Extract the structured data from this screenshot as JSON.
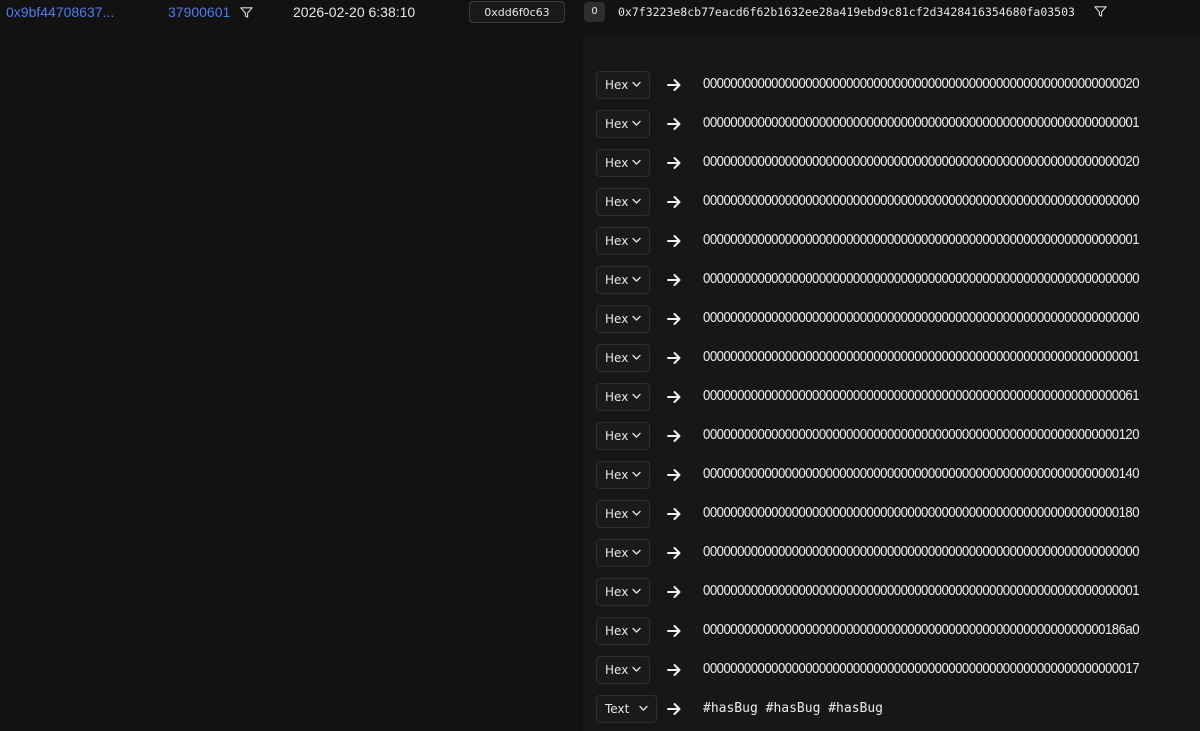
{
  "log_row": {
    "tx_hash": "0x9bf44708637...",
    "block_number": "37900601",
    "timestamp": "2026-02-20 6:38:10",
    "method": "0xdd6f0c63",
    "log_index": "0",
    "topic": "0x7f3223e8cb77eacd6f62b1632ee28a419ebd9c81cf2d3428416354680fa03503",
    "link_color": "#4d7cf0"
  },
  "decoded_rows": [
    {
      "format": "Hex",
      "value": "0000000000000000000000000000000000000000000000000000000000000020"
    },
    {
      "format": "Hex",
      "value": "0000000000000000000000000000000000000000000000000000000000000001"
    },
    {
      "format": "Hex",
      "value": "0000000000000000000000000000000000000000000000000000000000000020"
    },
    {
      "format": "Hex",
      "value": "0000000000000000000000000000000000000000000000000000000000000000"
    },
    {
      "format": "Hex",
      "value": "0000000000000000000000000000000000000000000000000000000000000001"
    },
    {
      "format": "Hex",
      "value": "0000000000000000000000000000000000000000000000000000000000000000"
    },
    {
      "format": "Hex",
      "value": "0000000000000000000000000000000000000000000000000000000000000000"
    },
    {
      "format": "Hex",
      "value": "0000000000000000000000000000000000000000000000000000000000000001"
    },
    {
      "format": "Hex",
      "value": "0000000000000000000000000000000000000000000000000000000000000061"
    },
    {
      "format": "Hex",
      "value": "0000000000000000000000000000000000000000000000000000000000000120"
    },
    {
      "format": "Hex",
      "value": "0000000000000000000000000000000000000000000000000000000000000140"
    },
    {
      "format": "Hex",
      "value": "0000000000000000000000000000000000000000000000000000000000000180"
    },
    {
      "format": "Hex",
      "value": "0000000000000000000000000000000000000000000000000000000000000000"
    },
    {
      "format": "Hex",
      "value": "0000000000000000000000000000000000000000000000000000000000000001"
    },
    {
      "format": "Hex",
      "value": "00000000000000000000000000000000000000000000000000000000000186a0"
    },
    {
      "format": "Hex",
      "value": "0000000000000000000000000000000000000000000000000000000000000017"
    },
    {
      "format": "Text",
      "value": "#hasBug #hasBug #hasBug"
    }
  ],
  "icons": {
    "filter": "filter-icon",
    "chevron": "chevron-down-icon",
    "arrow": "arrow-right-icon"
  }
}
